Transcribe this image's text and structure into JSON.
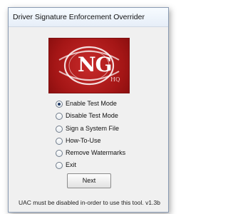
{
  "window": {
    "title": "Driver Signature Enforcement Overrider"
  },
  "logo": {
    "main_text": "NG",
    "sub_text": "HQ"
  },
  "options": [
    {
      "label": "Enable Test Mode",
      "selected": true
    },
    {
      "label": "Disable Test Mode",
      "selected": false
    },
    {
      "label": "Sign a System File",
      "selected": false
    },
    {
      "label": "How-To-Use",
      "selected": false
    },
    {
      "label": "Remove Watermarks",
      "selected": false
    },
    {
      "label": "Exit",
      "selected": false
    }
  ],
  "buttons": {
    "next_label": "Next"
  },
  "status_bar": {
    "message": "UAC must be disabled in-order to use this tool.",
    "version": "v1.3b"
  },
  "colors": {
    "logo_red": "#b01e1e",
    "window_bg": "#f0f0f0"
  }
}
